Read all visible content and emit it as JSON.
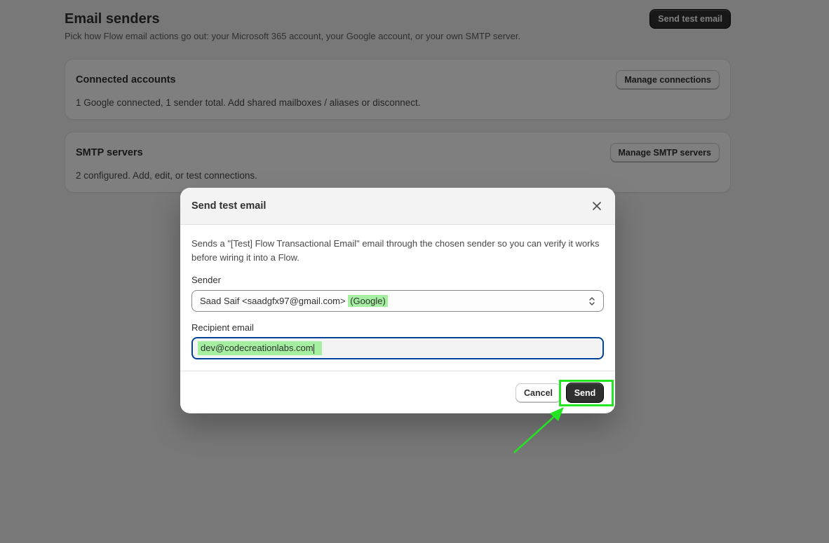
{
  "page": {
    "title": "Email senders",
    "subtitle": "Pick how Flow email actions go out: your Microsoft 365 account, your Google account, or your own SMTP server.",
    "send_test_button": "Send test email"
  },
  "cards": {
    "connected": {
      "title": "Connected accounts",
      "text": "1 Google connected, 1 sender total. Add shared mailboxes / aliases or disconnect.",
      "button": "Manage connections"
    },
    "smtp": {
      "title": "SMTP servers",
      "text": "2 configured. Add, edit, or test connections.",
      "button": "Manage SMTP servers"
    }
  },
  "modal": {
    "title": "Send test email",
    "description": "Sends a \"[Test] Flow Transactional Email\" email through the chosen sender so you can verify it works before wiring it into a Flow.",
    "sender_label": "Sender",
    "sender_value": "Saad Saif <saadgfx97@gmail.com>",
    "sender_provider": "(Google)",
    "recipient_label": "Recipient email",
    "recipient_value": "dev@codecreationlabs.com",
    "cancel_button": "Cancel",
    "send_button": "Send"
  },
  "icons": {
    "close": "close-icon",
    "select_chevron": "chevron-up-down-icon"
  },
  "colors": {
    "primary_button": "#303030",
    "focus_ring": "#004299",
    "highlight": "#a4f0a0",
    "annotation": "#22e622"
  }
}
